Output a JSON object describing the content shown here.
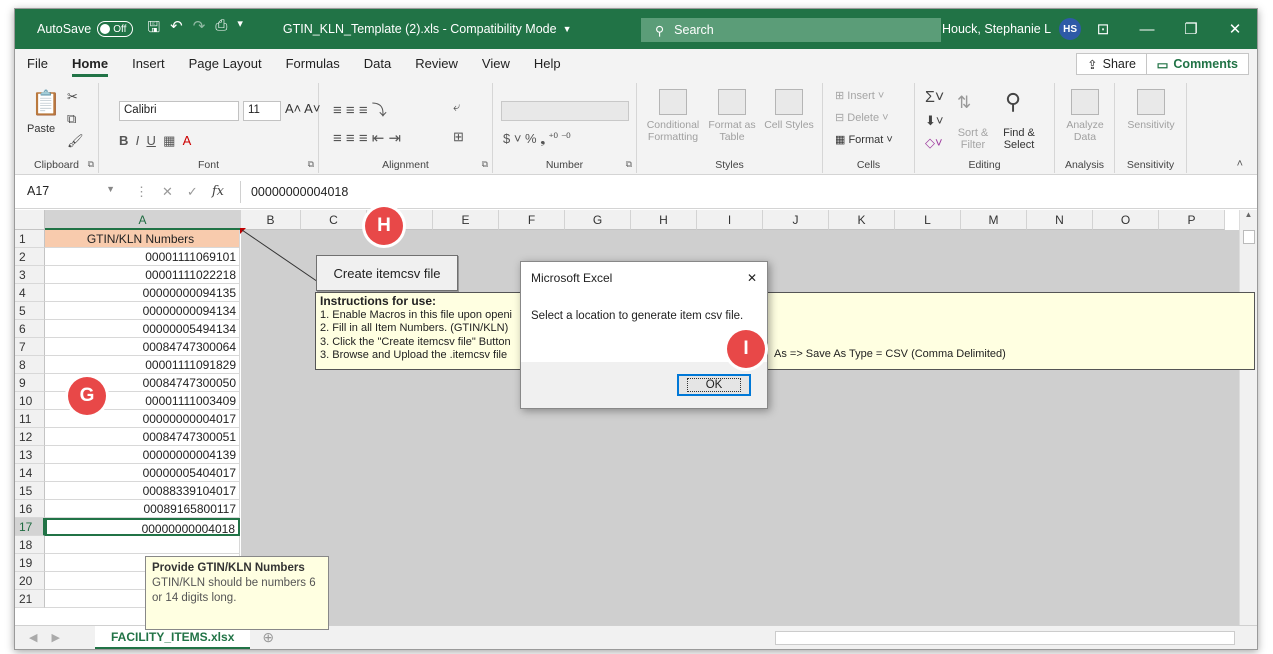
{
  "titlebar": {
    "autosave_label": "AutoSave",
    "autosave_state": "Off",
    "doc_title": "GTIN_KLN_Template (2).xls  -  Compatibility Mode",
    "search_placeholder": "Search",
    "user_name": "Houck, Stephanie L",
    "user_initials": "HS"
  },
  "ribbon_tabs": [
    "File",
    "Home",
    "Insert",
    "Page Layout",
    "Formulas",
    "Data",
    "Review",
    "View",
    "Help"
  ],
  "share_label": "Share",
  "comments_label": "Comments",
  "ribbon": {
    "paste_label": "Paste",
    "font_name": "Calibri",
    "font_size": "11",
    "groups": {
      "clipboard": "Clipboard",
      "font": "Font",
      "alignment": "Alignment",
      "number": "Number",
      "styles": "Styles",
      "cells": "Cells",
      "editing": "Editing",
      "analysis": "Analysis",
      "sensitivity": "Sensitivity"
    },
    "styles_buttons": [
      "Conditional Formatting",
      "Format as Table",
      "Cell Styles"
    ],
    "cells_buttons": [
      "Insert",
      "Delete",
      "Format"
    ],
    "editing_sort": "Sort & Filter",
    "editing_find": "Find & Select",
    "analyze_label": "Analyze Data",
    "sensitivity_label": "Sensitivity"
  },
  "formula_bar": {
    "name_box": "A17",
    "fx": "fx",
    "value": "00000000004018"
  },
  "columns": [
    "A",
    "B",
    "C",
    "D",
    "E",
    "F",
    "G",
    "H",
    "I",
    "J",
    "K",
    "L",
    "M",
    "N",
    "O",
    "P"
  ],
  "rows": [
    "1",
    "2",
    "3",
    "4",
    "5",
    "6",
    "7",
    "8",
    "9",
    "10",
    "11",
    "12",
    "13",
    "14",
    "15",
    "16",
    "17",
    "18",
    "19",
    "20",
    "21"
  ],
  "column_a": {
    "header": "GTIN/KLN Numbers",
    "values": [
      "00001111069101",
      "00001111022218",
      "00000000094135",
      "00000000094134",
      "00000005494134",
      "00084747300064",
      "00001111091829",
      "00084747300050",
      "00001111003409",
      "00000000004017",
      "00084747300051",
      "00000000004139",
      "00000005404017",
      "00088339104017",
      "00089165800117",
      "00000000004018"
    ]
  },
  "create_button": "Create itemcsv file",
  "instructions": {
    "title": "Instructions for use:",
    "lines": [
      "1. Enable Macros in this file upon openi",
      "2. Fill in all Item Numbers. (GTIN/KLN)",
      "3. Click the \"Create itemcsv file\" Button",
      "3. Browse and Upload the .itemcsv file"
    ],
    "tail": "As => Save As Type = CSV (Comma Delimited)"
  },
  "tooltip": {
    "title": "Provide GTIN/KLN Numbers",
    "body": "GTIN/KLN should be numbers 6 or 14 digits long."
  },
  "dialog": {
    "title": "Microsoft Excel",
    "message": "Select a location to generate item csv file.",
    "ok": "OK"
  },
  "sheet_tab": "FACILITY_ITEMS.xlsx",
  "badges": {
    "g": "G",
    "h": "H",
    "i": "I"
  },
  "colors": {
    "excel_green": "#217346",
    "header_fill": "#f8cbad",
    "badge_red": "#e84848",
    "note_yellow": "#ffffe1"
  }
}
